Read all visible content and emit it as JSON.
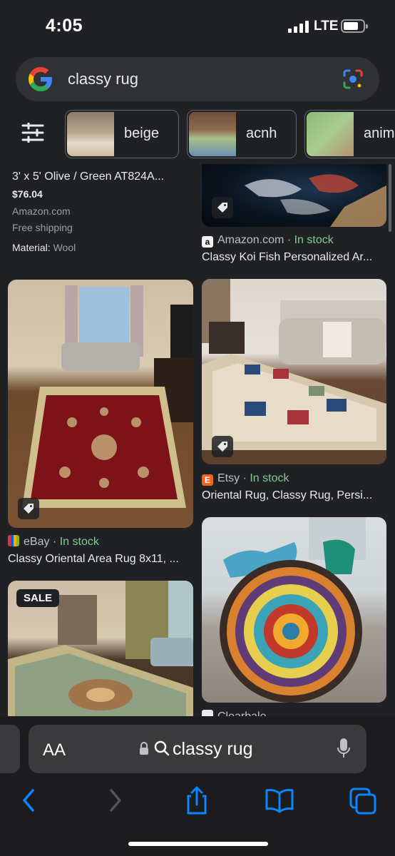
{
  "status": {
    "time": "4:05",
    "network": "LTE"
  },
  "search": {
    "query": "classy rug"
  },
  "chips": [
    {
      "label": "beige"
    },
    {
      "label": "acnh"
    },
    {
      "label": "anim"
    }
  ],
  "results": {
    "top_left": {
      "title": "3' x 5' Olive / Green AT824A...",
      "price": "$76.04",
      "source": "Amazon.com",
      "shipping": "Free shipping",
      "material_label": "Material:",
      "material_value": "Wool"
    },
    "top_right": {
      "source": "Amazon.com",
      "separator": "·",
      "stock": "In stock",
      "title": "Classy Koi Fish Personalized Ar..."
    },
    "mid_left": {
      "source": "eBay",
      "separator": "·",
      "stock": "In stock",
      "title": "Classy Oriental Area Rug 8x11, ..."
    },
    "mid_right": {
      "source": "Etsy",
      "separator": "·",
      "stock": "In stock",
      "title": "Oriental Rug, Classy Rug, Persi..."
    },
    "bottom_left": {
      "badge": "SALE"
    },
    "bottom_right": {
      "source": "Clearbale"
    }
  },
  "browser": {
    "aa_label": "AA",
    "url_text": "classy rug"
  },
  "colors": {
    "background": "#202124",
    "in_stock": "#81c995",
    "accent_blue": "#0a84ff",
    "etsy": "#f1641e"
  }
}
